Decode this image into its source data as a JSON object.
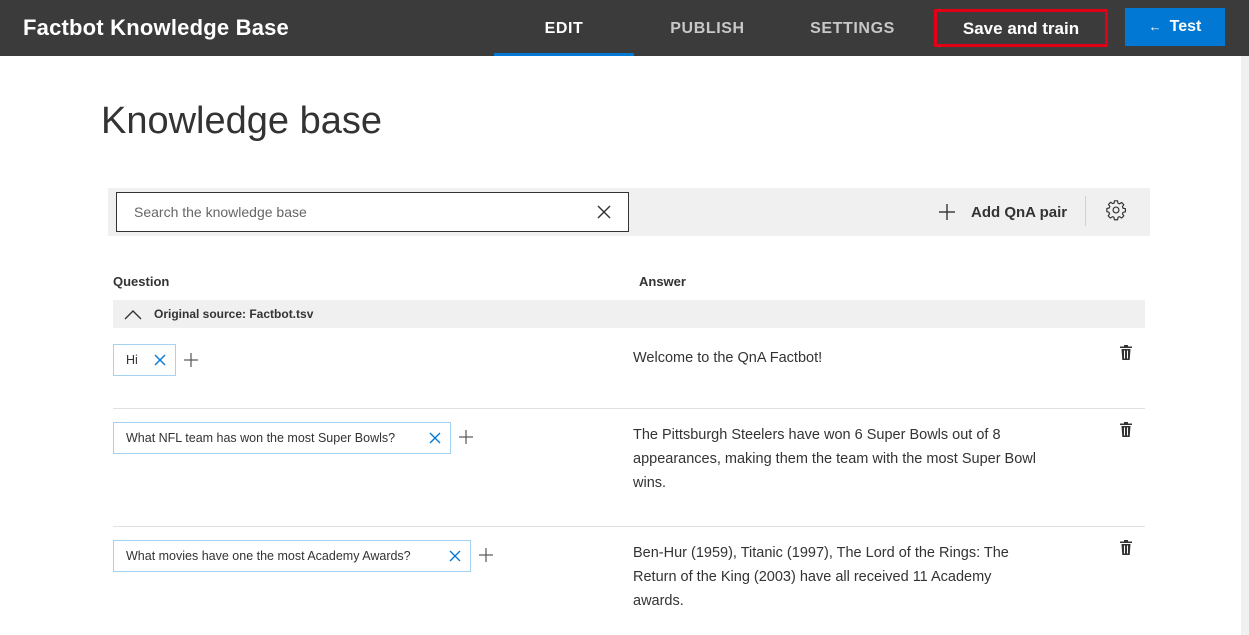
{
  "header": {
    "app_title": "Factbot Knowledge Base",
    "tabs": [
      {
        "label": "EDIT",
        "active": true
      },
      {
        "label": "PUBLISH",
        "active": false
      },
      {
        "label": "SETTINGS",
        "active": false
      }
    ],
    "save_label": "Save and train",
    "test_label": "Test",
    "accent_color": "#0078d4",
    "highlight_color": "#e30016"
  },
  "main": {
    "page_title": "Knowledge base",
    "search": {
      "placeholder": "Search the knowledge base",
      "value": ""
    },
    "add_pair_label": "Add QnA pair",
    "columns": {
      "question": "Question",
      "answer": "Answer"
    },
    "group": {
      "label": "Original source: Factbot.tsv"
    },
    "pairs": [
      {
        "question": "Hi",
        "answer": "Welcome to the QnA Factbot!"
      },
      {
        "question": "What NFL team has won the most Super Bowls?",
        "answer": "The Pittsburgh Steelers have won 6 Super Bowls out of 8 appearances, making them the team with the most Super Bowl wins."
      },
      {
        "question": "What movies have one the most Academy Awards?",
        "answer": "Ben-Hur (1959), Titanic (1997), The Lord of the Rings: The Return of the King (2003) have all received 11 Academy awards."
      }
    ]
  }
}
